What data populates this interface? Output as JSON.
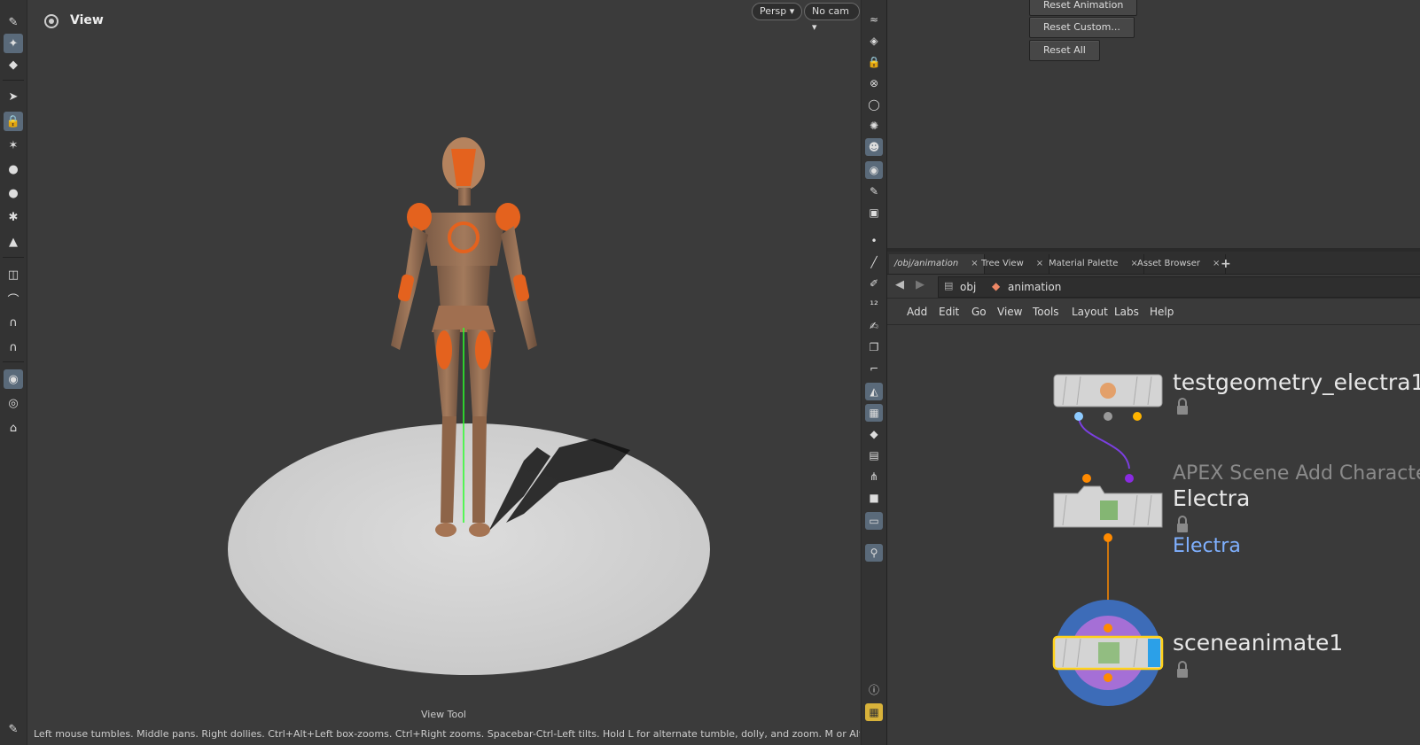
{
  "viewport": {
    "title": "View",
    "persp_label": "Persp ▾",
    "cam_label": "No cam ▾",
    "tool_label": "View Tool",
    "status_hint": "Left mouse tumbles. Middle pans. Right dollies. Ctrl+Alt+Left box-zooms. Ctrl+Right zooms. Spacebar-Ctrl-Left tilts. Hold L for alternate tumble, dolly, and zoom. M or Alt+M for First Person"
  },
  "params": {
    "buttons": [
      "Reset Animation",
      "Reset Custom...",
      "Reset All"
    ]
  },
  "tabs": [
    "/obj/animation",
    "Tree View",
    "Material Palette",
    "Asset Browser"
  ],
  "path": {
    "root": "obj",
    "current": "animation"
  },
  "menus": [
    "Add",
    "Edit",
    "Go",
    "View",
    "Tools",
    "Layout",
    "Labs",
    "Help"
  ],
  "nodes": {
    "n1": {
      "name": "testgeometry_electra1"
    },
    "n2": {
      "type": "APEX Scene Add Character",
      "name": "Electra",
      "comment": "Electra"
    },
    "n3": {
      "name": "sceneanimate1"
    }
  },
  "colors": {
    "accent_orange": "#ff8a00",
    "wire_purple": "#7b3fe0",
    "display_flag_blue": "#2ba0e8",
    "selected_outline": "#ffd21a",
    "comment_blue": "#7fb0ff"
  }
}
